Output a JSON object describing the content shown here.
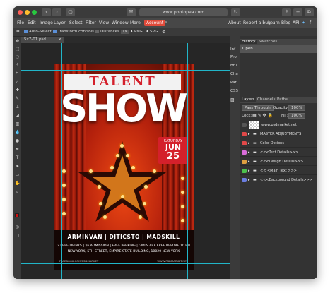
{
  "browser": {
    "url": "www.photopea.com",
    "buttons": [
      "‹",
      "›",
      "▢",
      "⛨"
    ],
    "icon_names": [
      "back-icon",
      "forward-icon",
      "sidebar-icon",
      "shield-icon"
    ]
  },
  "menu": {
    "items": [
      "File",
      "Edit",
      "Image",
      "Layer",
      "Select",
      "Filter",
      "View",
      "Window",
      "More"
    ],
    "account": "Account",
    "right": [
      "About",
      "Report a bug",
      "Learn",
      "Blog",
      "API"
    ]
  },
  "options": {
    "auto_select": "Auto-Select",
    "transform_controls": "Transform controls",
    "distances": "Distances",
    "zoom": "1x",
    "png": "PNG",
    "svg": "SVG"
  },
  "document": {
    "tab": "5x7-01.psd"
  },
  "poster": {
    "top_word": "TALENT",
    "main_word": "SHOW",
    "date_day": "SATURDAY",
    "date_month": "JUN",
    "date_num": "25",
    "names": "ARMINVAN | DJTICSTO | MADSKILL",
    "info1": "2 FREE DRINKS | $6 ADMISSION | FREE PARKING | GIRLS ARE FREE BEFORE 10 PM",
    "info2": "NEW YORK, 5TH STREET, EMPIRE STATE BUILDING, 10020 NEW YORK",
    "social_left": "FACEBOOK.COM/PSDMARKET",
    "social_right": "WWW.PSDMARKET.NET"
  },
  "side_tabs": [
    "Inf",
    "Pro",
    "Bru",
    "Cha",
    "Par",
    "CSS"
  ],
  "history_panel": {
    "tabs": [
      "History",
      "Swatches"
    ],
    "item": "Open"
  },
  "layers_panel": {
    "tabs": [
      "Layers",
      "Channels",
      "Paths"
    ],
    "blend_mode": "Pass Through",
    "opacity_label": "Opacity:",
    "opacity_value": "100%",
    "lock_label": "Lock:",
    "fill_label": "Fill:",
    "fill_value": "100%",
    "layers": [
      {
        "name": "www.psdmarket.net",
        "color": "#333333"
      },
      {
        "name": "MASTER ADJUSTMENTS",
        "color": "#e04848"
      },
      {
        "name": "Color Options",
        "color": "#e04848"
      },
      {
        "name": "<<<Text Details>>>",
        "color": "#d86bd8"
      },
      {
        "name": "<<<Design Details>>>",
        "color": "#e0a040"
      },
      {
        "name": "<< <Main Text >>>",
        "color": "#4cc04c"
      },
      {
        "name": "<<<Backgorund Details>>>",
        "color": "#6a7de0"
      }
    ]
  },
  "bottom_icons": [
    "↪",
    "◐",
    "▣",
    "▤",
    "⊞",
    "🗑"
  ]
}
